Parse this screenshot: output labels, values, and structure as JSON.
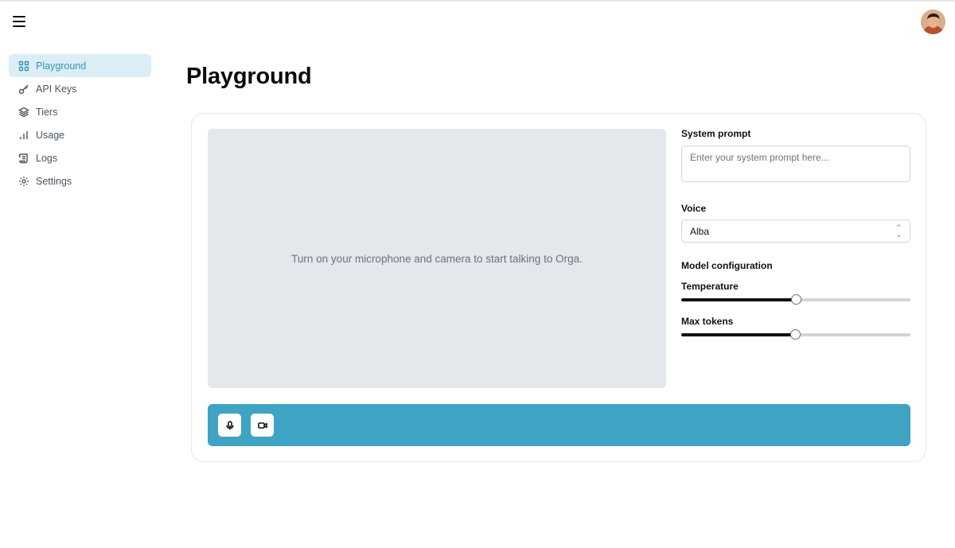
{
  "header": {
    "menu_icon": "hamburger-menu-icon",
    "avatar_icon": "user-avatar"
  },
  "sidebar": {
    "items": [
      {
        "label": "Playground",
        "icon": "grid-icon",
        "active": true
      },
      {
        "label": "API Keys",
        "icon": "key-icon",
        "active": false
      },
      {
        "label": "Tiers",
        "icon": "layers-icon",
        "active": false
      },
      {
        "label": "Usage",
        "icon": "bar-chart-icon",
        "active": false
      },
      {
        "label": "Logs",
        "icon": "scroll-icon",
        "active": false
      },
      {
        "label": "Settings",
        "icon": "gear-icon",
        "active": false
      }
    ]
  },
  "main": {
    "title": "Playground",
    "video_message": "Turn on your microphone and camera to start talking to Orga.",
    "system_prompt": {
      "label": "System prompt",
      "placeholder": "Enter your system prompt here...",
      "value": ""
    },
    "voice": {
      "label": "Voice",
      "selected": "Alba"
    },
    "model_config": {
      "label": "Model configuration",
      "temperature": {
        "label": "Temperature",
        "value_fraction": 0.5
      },
      "max_tokens": {
        "label": "Max tokens",
        "value_fraction": 0.497
      }
    },
    "controls": {
      "mic_icon": "microphone-icon",
      "camera_icon": "video-camera-icon"
    }
  },
  "colors": {
    "accent": "#3fa3c4",
    "active_nav_bg": "#dbeef6",
    "active_nav_text": "#3592b3",
    "video_bg": "#e4e7eb"
  }
}
